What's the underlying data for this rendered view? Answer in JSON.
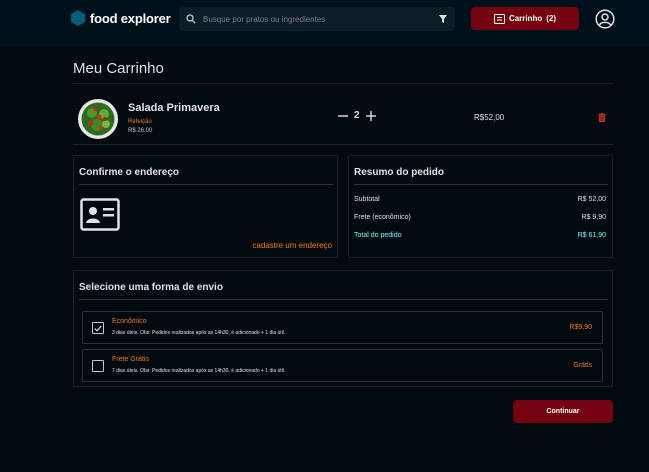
{
  "header": {
    "brand": "food explorer",
    "search_placeholder": "Busque por pratos ou ingredientes",
    "cart_label": "Carrinho",
    "cart_count": "(2)"
  },
  "page": {
    "title": "Meu Carrinho"
  },
  "cart_items": [
    {
      "name": "Salada Primavera",
      "category": "Refeição",
      "unit_price": "R$ 26,00",
      "quantity": "2",
      "total": "R$52,00",
      "image": "salad-bowl-image"
    }
  ],
  "address": {
    "title": "Confirme o endereço",
    "icon": "address-card-icon",
    "link": "cadastre um endereço"
  },
  "summary": {
    "title": "Resumo do pedido",
    "rows": [
      {
        "label": "Subtotal",
        "value": "R$ 52,00"
      },
      {
        "label": "Frete (econômico)",
        "value": "R$ 9,90"
      },
      {
        "label": "Total do pedido",
        "value": "R$ 61,90"
      }
    ]
  },
  "shipping": {
    "title": "Selecione uma forma de envio",
    "options": [
      {
        "name": "Econômico",
        "desc": "3 dias úteis. Obs: Pedidos realizados após as 14h30, é adicionado + 1 dia útil.",
        "price": "R$9,90",
        "checked": true
      },
      {
        "name": "Frete Grátis",
        "desc": "7 dias úteis. Obs: Pedidos realizados após as 14h30, é adicionado + 1 dia útil.",
        "price": "Grátis",
        "checked": false
      }
    ]
  },
  "continue_label": "Continuar",
  "colors": {
    "background": "#000a0f",
    "header": "#00111a",
    "accent_red": "#750310",
    "accent_orange": "#fb7c13",
    "accent_cyan": "#82f3ff",
    "logo_blue": "#065e7c"
  }
}
